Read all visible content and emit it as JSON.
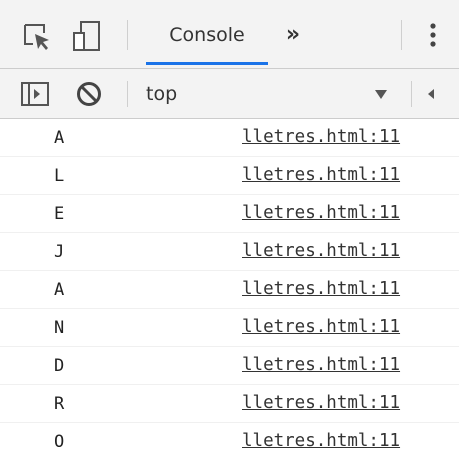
{
  "tabbar": {
    "active_tab": "Console",
    "more_tabs_glyph": "»",
    "icons": [
      "inspect-element-icon",
      "device-toolbar-icon",
      "more-tabs-icon",
      "kebab-menu-icon"
    ]
  },
  "toolbar": {
    "context_value": "top",
    "icons": [
      "sidebar-toggle-icon",
      "clear-console-icon",
      "dropdown-arrow-icon",
      "collapse-arrow-icon"
    ]
  },
  "colors": {
    "tab_accent": "#1a73e8",
    "toolbar_bg": "#f3f3f3",
    "text": "#333333"
  },
  "console": {
    "messages": [
      {
        "text": "A",
        "source": "lletres.html:11"
      },
      {
        "text": "L",
        "source": "lletres.html:11"
      },
      {
        "text": "E",
        "source": "lletres.html:11"
      },
      {
        "text": "J",
        "source": "lletres.html:11"
      },
      {
        "text": "A",
        "source": "lletres.html:11"
      },
      {
        "text": "N",
        "source": "lletres.html:11"
      },
      {
        "text": "D",
        "source": "lletres.html:11"
      },
      {
        "text": "R",
        "source": "lletres.html:11"
      },
      {
        "text": "O",
        "source": "lletres.html:11"
      }
    ]
  }
}
